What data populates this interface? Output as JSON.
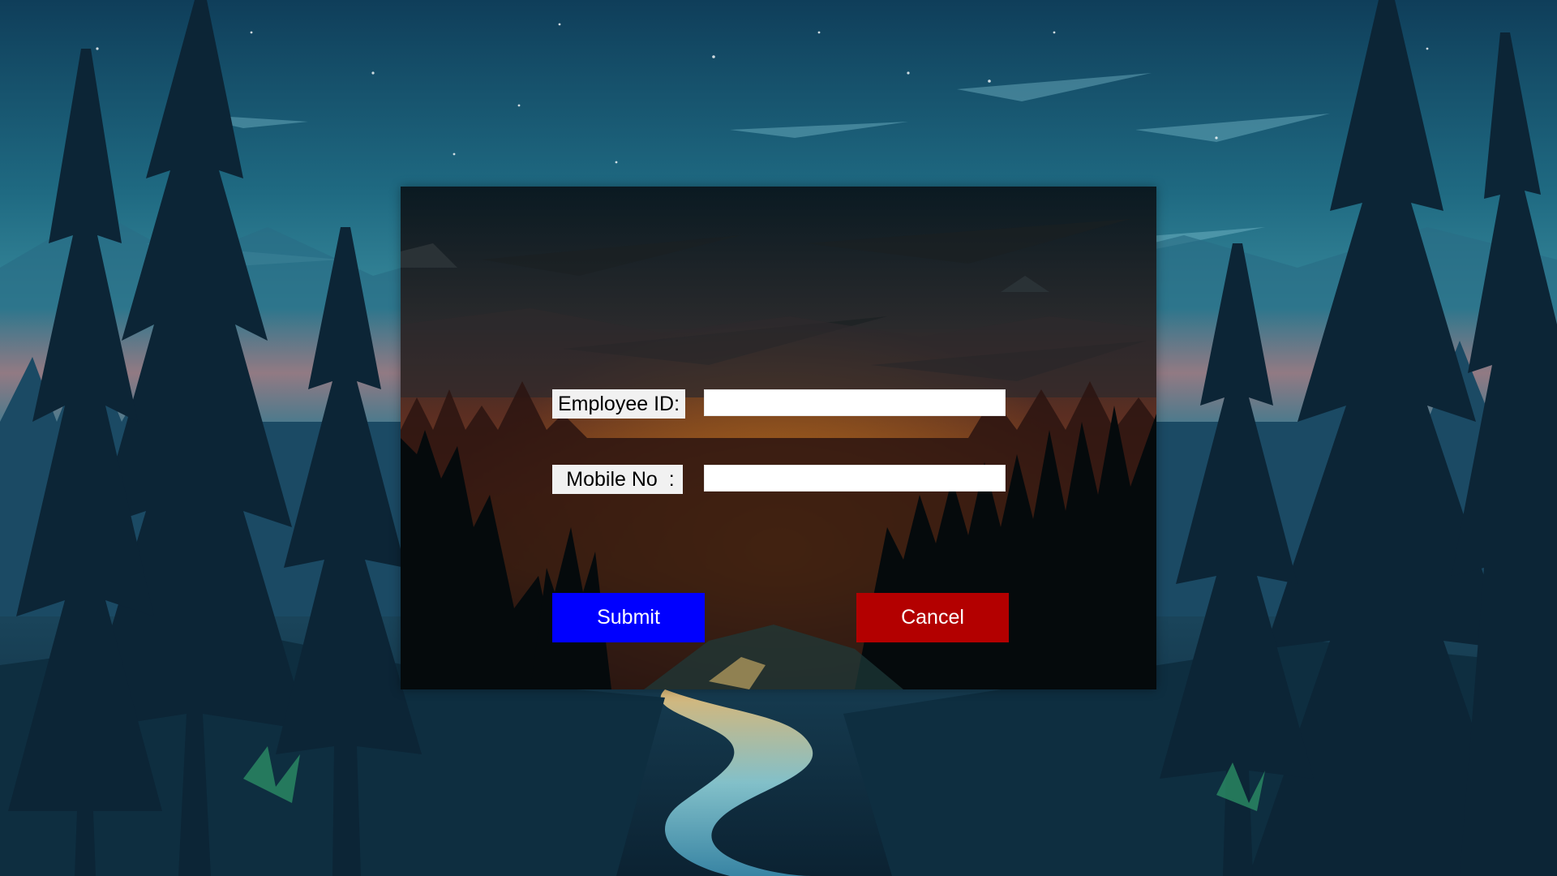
{
  "form": {
    "employee_id_label": "Employee ID:",
    "employee_id_value": "",
    "mobile_label": " Mobile No  :",
    "mobile_value": "",
    "submit_label": "Submit",
    "cancel_label": "Cancel"
  },
  "colors": {
    "submit": "#0000ff",
    "cancel": "#b30000",
    "label_bg": "#f1f1f1"
  }
}
